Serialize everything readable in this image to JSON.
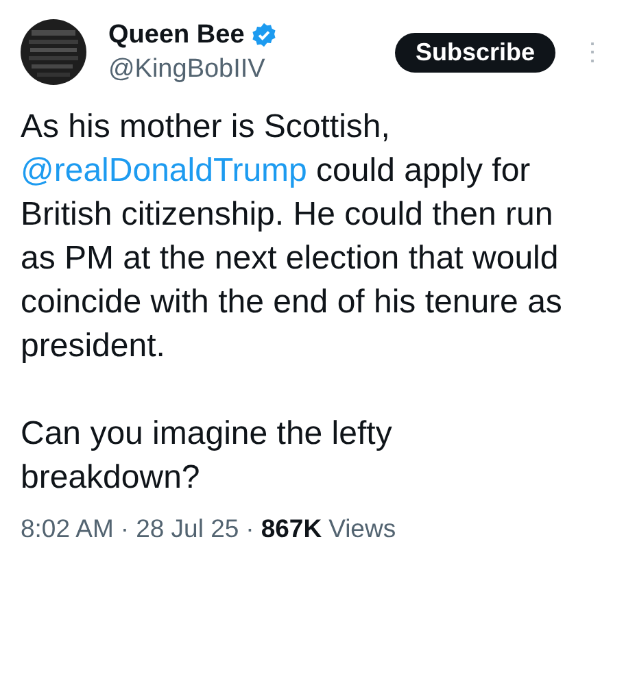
{
  "author": {
    "name": "Queen Bee",
    "verified": true,
    "handle": "@KingBobIIV"
  },
  "subscribe_button": "Subscribe",
  "menu_icon": "⋮",
  "paragraphs": [
    [
      {
        "text": "As his mother is Scottish, ",
        "link": false
      },
      {
        "text": "@realDonaldTrump",
        "link": true
      },
      {
        "text": " could apply for British citizenship. He could then run as PM at the next election that would coincide with the end of his tenure as president.",
        "link": false
      }
    ],
    [
      {
        "text": "Can you imagine the lefty breakdown?",
        "link": false
      }
    ]
  ],
  "meta": {
    "time": "8:02 AM",
    "separator_1": "·",
    "date": "28 Jul 25",
    "separator_2": "·",
    "views_count": "867K",
    "views_label": "Views"
  }
}
